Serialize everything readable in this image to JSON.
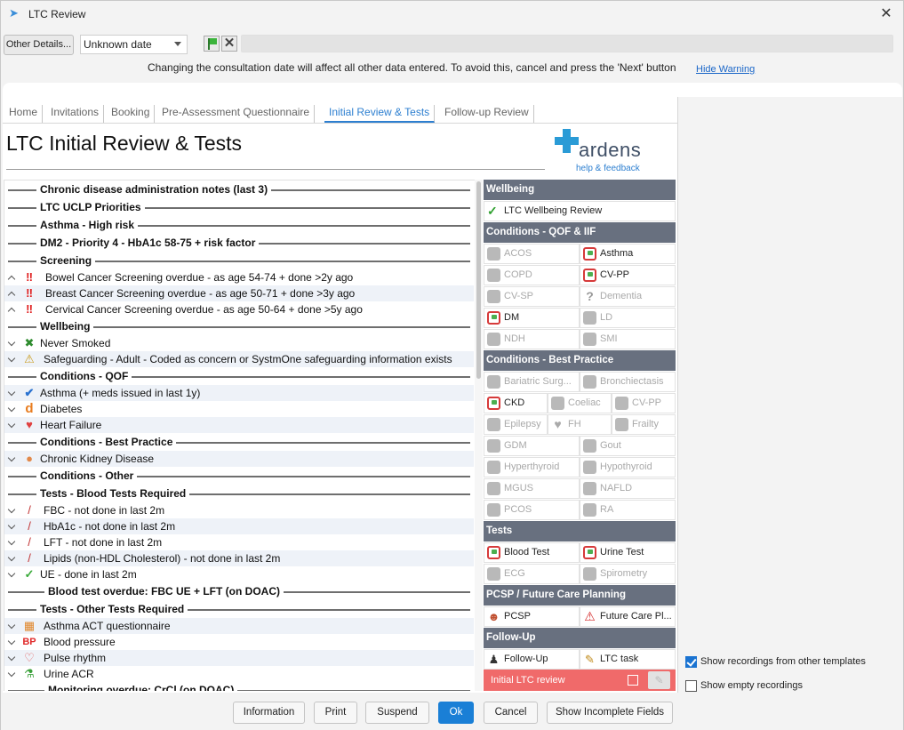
{
  "window": {
    "title": "LTC Review"
  },
  "toolbar": {
    "other_details": "Other Details...",
    "date_value": "Unknown date",
    "warning": "Changing the consultation date will affect all other data entered. To avoid this, cancel and press the 'Next' button",
    "hide_warning": "Hide Warning"
  },
  "tabs": [
    "Home",
    "Invitations",
    "Booking",
    "Pre-Assessment Questionnaire",
    "Initial Review & Tests",
    "Follow-up Review"
  ],
  "page_title": "LTC Initial Review & Tests",
  "logo": {
    "word": "ardens",
    "help": "help & feedback"
  },
  "list": {
    "h1": "Chronic disease administration notes (last 3)",
    "h2": "LTC UCLP Priorities",
    "h3": "Asthma - High risk",
    "h4": "DM2 - Priority 4 - HbA1c 58-75 + risk factor",
    "h5": "Screening",
    "r1": "Bowel Cancer Screening overdue - as age 54-74 + done >2y ago",
    "r2": "Breast Cancer Screening overdue - as age 50-71 + done >3y ago",
    "r3": "Cervical Cancer Screening overdue - as age 50-64 + done >5y ago",
    "h6": "Wellbeing",
    "r4": "Never Smoked",
    "r5": "Safeguarding - Adult - Coded as concern or SystmOne safeguarding information exists",
    "h7": "Conditions - QOF",
    "r6": "Asthma (+ meds issued in last 1y)",
    "r7": "Diabetes",
    "r8": "Heart Failure",
    "h8": "Conditions - Best Practice",
    "r9": "Chronic Kidney Disease",
    "h9": "Conditions - Other",
    "h10": "Tests - Blood Tests Required",
    "r10": "FBC - not done in last 2m",
    "r11": "HbA1c - not done in last 2m",
    "r12": "LFT - not done in last 2m",
    "r13": "Lipids (non-HDL Cholesterol) - not done in last 2m",
    "r14": "UE - done in last 2m",
    "h11": "Blood test overdue: FBC UE + LFT (on DOAC)",
    "h12": "Tests - Other Tests Required",
    "r15": "Asthma ACT questionnaire",
    "r16": "Blood pressure",
    "r17": "Pulse rhythm",
    "r18": "Urine ACR",
    "h13": "Monitoring overdue: CrCl (on DOAC)"
  },
  "panel": {
    "wellbeing": "Wellbeing",
    "ltc_wellbeing": "LTC Wellbeing Review",
    "cond_qof": "Conditions - QOF & IIF",
    "acos": "ACOS",
    "asthma": "Asthma",
    "copd": "COPD",
    "cvpp": "CV-PP",
    "cvsp": "CV-SP",
    "dementia": "Dementia",
    "dm": "DM",
    "ld": "LD",
    "ndh": "NDH",
    "smi": "SMI",
    "cond_bp": "Conditions - Best Practice",
    "bariatric": "Bariatric Surg...",
    "bronch": "Bronchiectasis",
    "ckd": "CKD",
    "coeliac": "Coeliac",
    "cvpp2": "CV-PP",
    "epilepsy": "Epilepsy",
    "fh": "FH",
    "frailty": "Frailty",
    "gdm": "GDM",
    "gout": "Gout",
    "hyper": "Hyperthyroid",
    "hypo": "Hypothyroid",
    "mgus": "MGUS",
    "nafld": "NAFLD",
    "pcos": "PCOS",
    "ra": "RA",
    "tests": "Tests",
    "blood": "Blood Test",
    "urine": "Urine Test",
    "ecg": "ECG",
    "spiro": "Spirometry",
    "pcsp_hdr": "PCSP / Future Care Planning",
    "pcsp": "PCSP",
    "future": "Future Care Pl...",
    "followup_hdr": "Follow-Up",
    "followup": "Follow-Up",
    "ltctask": "LTC task",
    "initial_ltc": "Initial LTC review"
  },
  "options": {
    "other_templates": "Show recordings from other templates",
    "empty": "Show empty recordings"
  },
  "footer": {
    "information": "Information",
    "print": "Print",
    "suspend": "Suspend",
    "ok": "Ok",
    "cancel": "Cancel",
    "incomplete": "Show Incomplete Fields"
  },
  "colors": {
    "accent": "#2d7fd0",
    "section": "#68707f",
    "alert": "#f06a6a",
    "ok": "#1a7fd6"
  }
}
